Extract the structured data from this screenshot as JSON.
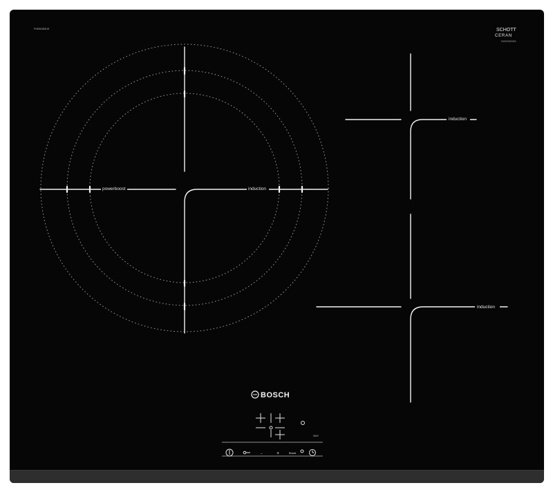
{
  "model_code": "PXE651BE1E",
  "schott_logo": {
    "line1": "SCHOTT",
    "line2": "CERAN"
  },
  "ceran_code": "XXXXXXXXX",
  "zones": {
    "large": {
      "left_label": "powerboost",
      "right_label": "induction"
    },
    "top_right": {
      "label": "induction"
    },
    "bottom_right": {
      "label": "induction"
    }
  },
  "brand": {
    "name": "BOSCH",
    "icon": "bosch-armature-icon"
  },
  "controls": {
    "timer_digit_icon": "timer-digit-icon",
    "sensor_icon": "sensor-circle-icon",
    "small_label": "SMS",
    "power_icon": "power-icon",
    "lock_icon": "key-lock-icon",
    "minus_label": "−",
    "plus_label": "+",
    "boost_label": "Boost",
    "timer_icon": "clock-icon"
  }
}
